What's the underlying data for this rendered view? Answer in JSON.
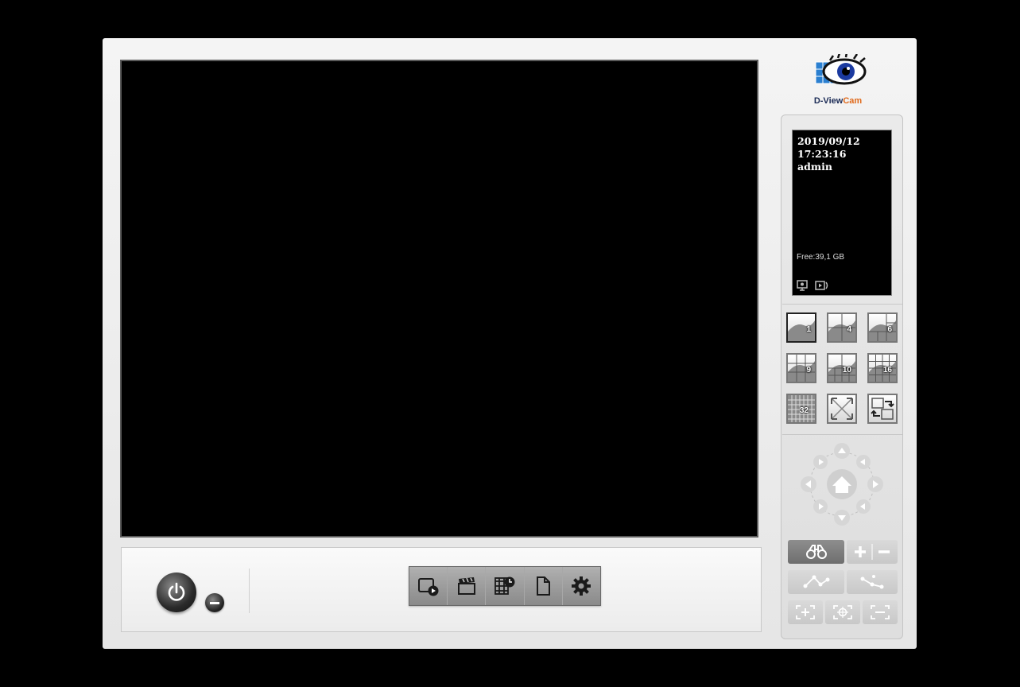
{
  "brand": {
    "logo_text_a": "D-View",
    "logo_text_b": "Cam",
    "accent_color": "#e06a1c",
    "primary_color": "#1a2a55"
  },
  "info": {
    "date": "2019/09/12",
    "time": "17:23:16",
    "user": "admin",
    "free_space": "Free:39,1 GB",
    "icons": [
      "monitor-icon",
      "playback-icon"
    ]
  },
  "layouts": [
    {
      "label": "1",
      "active": true
    },
    {
      "label": "4"
    },
    {
      "label": "6"
    },
    {
      "label": "9"
    },
    {
      "label": "10"
    },
    {
      "label": "16"
    },
    {
      "label": "32"
    },
    {
      "label": "",
      "icon": "fullscreen-icon"
    },
    {
      "label": "",
      "icon": "swap-icon"
    }
  ],
  "toolbar": {
    "icons": [
      "playback-button",
      "record-button",
      "schedule-button",
      "log-button",
      "settings-button"
    ]
  },
  "ptz": {
    "icons": [
      "up-arrow",
      "down-arrow",
      "left-arrow",
      "right-arrow",
      "home-icon"
    ]
  },
  "controls": {
    "icons": [
      "binoculars-icon",
      "zoom-in-icon",
      "zoom-out-icon",
      "focus-near-icon",
      "focus-far-icon",
      "iris-open-icon",
      "auto-focus-icon",
      "iris-close-icon"
    ]
  }
}
